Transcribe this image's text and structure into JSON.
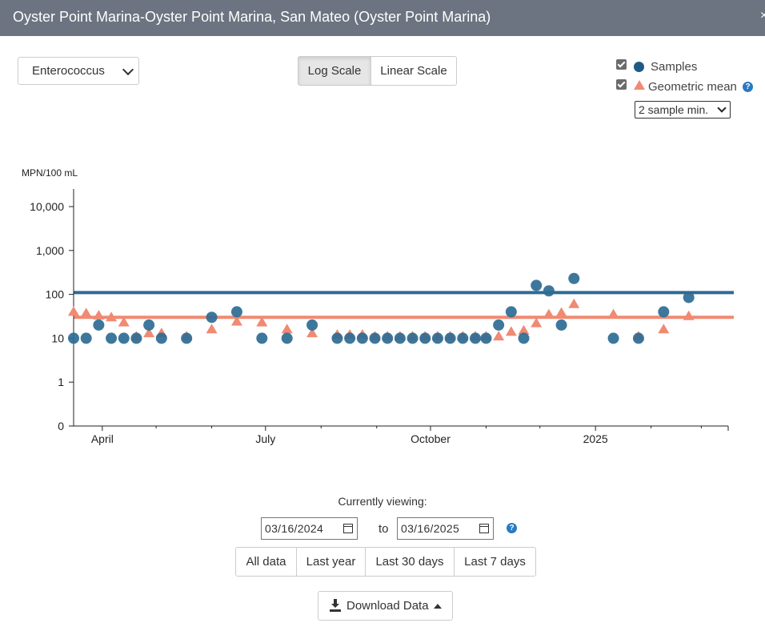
{
  "window": {
    "title": "Oyster Point Marina-Oyster Point Marina, San Mateo (Oyster Point Marina)",
    "close_label": "×"
  },
  "controls": {
    "analyte": "Enterococcus",
    "scale_buttons": [
      "Log Scale",
      "Linear Scale"
    ],
    "active_scale": "Log Scale",
    "legend": {
      "samples_label": "Samples",
      "geomean_label": "Geometric mean"
    },
    "min_samples": "2 sample min."
  },
  "chart_data": {
    "type": "scatter",
    "ylabel": "MPN/100 mL",
    "yscale": "log",
    "y_ticks": [
      0,
      1,
      10,
      100,
      1000,
      10000
    ],
    "y_tick_labels": [
      "0",
      "1",
      "10",
      "100",
      "1,000",
      "10,000"
    ],
    "x_tick_labels": [
      "April",
      "July",
      "October",
      "2025"
    ],
    "x_range": [
      "2024-03-16",
      "2025-03-16"
    ],
    "thresholds": [
      {
        "value": 110,
        "color": "#2e6b94"
      },
      {
        "value": 30,
        "color": "#f08a72"
      }
    ],
    "series": [
      {
        "name": "Samples",
        "marker": "circle",
        "color": "#2e6b94",
        "x": [
          "2024-03-16",
          "2024-03-23",
          "2024-03-30",
          "2024-04-06",
          "2024-04-13",
          "2024-04-20",
          "2024-04-27",
          "2024-05-04",
          "2024-05-18",
          "2024-06-01",
          "2024-06-15",
          "2024-06-29",
          "2024-07-13",
          "2024-07-27",
          "2024-08-10",
          "2024-08-17",
          "2024-08-24",
          "2024-08-31",
          "2024-09-07",
          "2024-09-14",
          "2024-09-21",
          "2024-09-28",
          "2024-10-05",
          "2024-10-12",
          "2024-10-19",
          "2024-10-26",
          "2024-11-01",
          "2024-11-08",
          "2024-11-15",
          "2024-11-22",
          "2024-11-29",
          "2024-12-06",
          "2024-12-13",
          "2024-12-20",
          "2025-01-11",
          "2025-01-25",
          "2025-02-08",
          "2025-02-22"
        ],
        "y": [
          10,
          10,
          20,
          10,
          10,
          10,
          20,
          10,
          10,
          30,
          40,
          10,
          10,
          20,
          10,
          10,
          10,
          10,
          10,
          10,
          10,
          10,
          10,
          10,
          10,
          10,
          10,
          20,
          40,
          10,
          160,
          120,
          20,
          230,
          10,
          10,
          40,
          85
        ]
      },
      {
        "name": "Geometric mean",
        "marker": "triangle",
        "color": "#f08a72",
        "x": [
          "2024-03-16",
          "2024-03-23",
          "2024-03-30",
          "2024-04-06",
          "2024-04-13",
          "2024-04-20",
          "2024-04-27",
          "2024-05-04",
          "2024-05-18",
          "2024-06-01",
          "2024-06-15",
          "2024-06-29",
          "2024-07-13",
          "2024-07-27",
          "2024-08-10",
          "2024-08-17",
          "2024-08-24",
          "2024-08-31",
          "2024-09-07",
          "2024-09-14",
          "2024-09-21",
          "2024-09-28",
          "2024-10-05",
          "2024-10-12",
          "2024-10-19",
          "2024-10-26",
          "2024-11-01",
          "2024-11-08",
          "2024-11-15",
          "2024-11-22",
          "2024-11-29",
          "2024-12-06",
          "2024-12-13",
          "2024-12-20",
          "2025-01-11",
          "2025-01-25",
          "2025-02-08",
          "2025-02-22"
        ],
        "y": [
          40,
          37,
          33,
          30,
          23,
          11,
          13,
          13,
          11,
          16,
          24,
          23,
          16,
          13,
          12,
          12,
          12,
          11,
          11,
          11,
          11,
          11,
          11,
          11,
          11,
          11,
          11,
          11,
          14,
          15,
          22,
          35,
          38,
          60,
          35,
          11,
          16,
          32
        ]
      }
    ]
  },
  "viewing": {
    "label": "Currently viewing:",
    "from": "03/16/2024",
    "to_label": "to",
    "to": "03/16/2025"
  },
  "range_buttons": [
    "All data",
    "Last year",
    "Last 30 days",
    "Last 7 days"
  ],
  "download": {
    "label": "Download Data"
  }
}
